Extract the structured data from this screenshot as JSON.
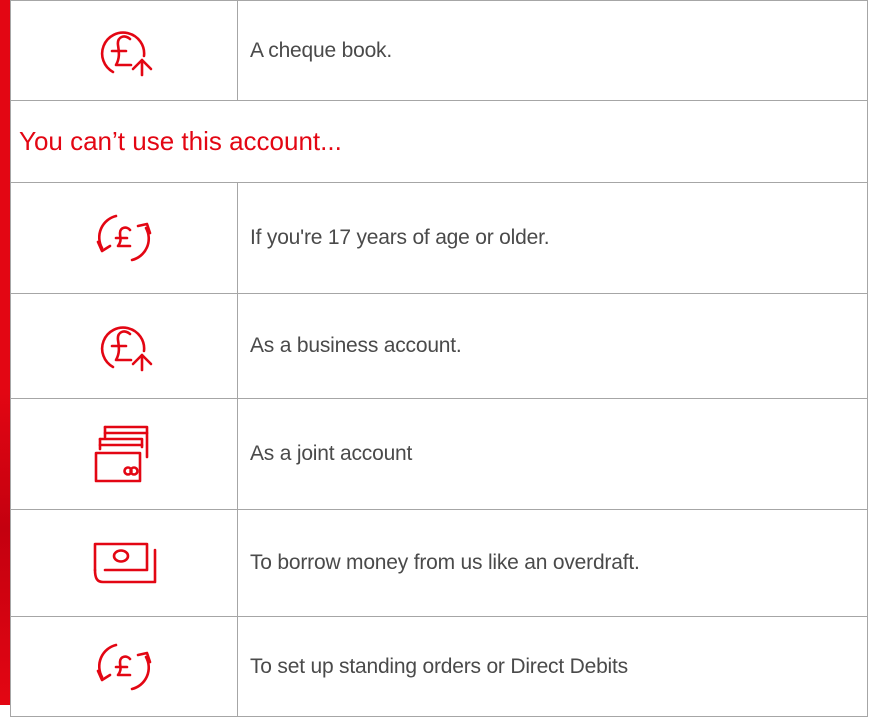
{
  "brand_color": "#e30613",
  "text_color": "#4a4a4a",
  "border_color": "#a6a6a6",
  "rows_top": [
    {
      "icon": "pound-arrow-icon",
      "text": "A cheque book."
    }
  ],
  "section": {
    "heading": "You can’t use this account..."
  },
  "rows_bottom": [
    {
      "icon": "pound-exchange-icon",
      "text": "If you're 17 years of age or older."
    },
    {
      "icon": "pound-arrow-icon",
      "text": "As a business account."
    },
    {
      "icon": "cards-icon",
      "text": "As a joint account"
    },
    {
      "icon": "banknote-icon",
      "text": "To borrow money from us like an overdraft."
    },
    {
      "icon": "pound-exchange-icon",
      "text": "To set up standing orders or Direct Debits"
    }
  ]
}
